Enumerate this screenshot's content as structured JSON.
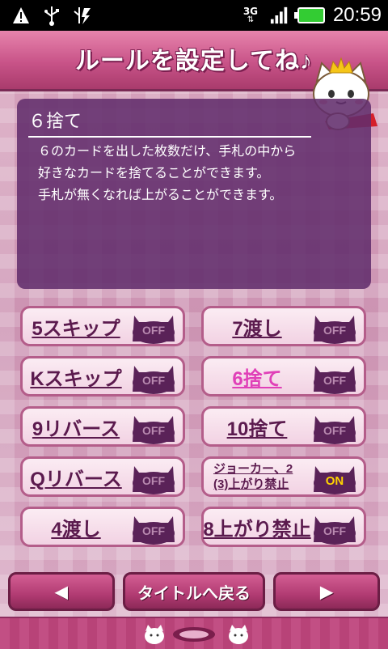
{
  "status_bar": {
    "network": "3G",
    "time": "20:59",
    "icons": [
      "warning-icon",
      "usb-icon",
      "usb-debug-icon",
      "signal-icon",
      "battery-icon"
    ]
  },
  "header": {
    "title": "ルールを設定してね♪"
  },
  "description": {
    "title": "６捨て",
    "lines": [
      "６のカードを出した枚数だけ、手札の中から",
      "好きなカードを捨てることができます。",
      "手札が無くなれば上がることができます。"
    ]
  },
  "rules": [
    {
      "label": "5スキップ",
      "state": "OFF"
    },
    {
      "label": "7渡し",
      "state": "OFF"
    },
    {
      "label": "Kスキップ",
      "state": "OFF"
    },
    {
      "label": "6捨て",
      "state": "OFF",
      "selected": true
    },
    {
      "label": "9リバース",
      "state": "OFF"
    },
    {
      "label": "10捨て",
      "state": "OFF"
    },
    {
      "label": "Qリバース",
      "state": "OFF"
    },
    {
      "label_line1": "ジョーカー、2",
      "label_line2": "(3)上がり禁止",
      "state": "ON"
    },
    {
      "label": "4渡し",
      "state": "OFF"
    },
    {
      "label": "8上がり禁止",
      "state": "OFF"
    }
  ],
  "nav": {
    "prev": "◀",
    "title_back": "タイトルへ戻る",
    "next": "▶"
  },
  "colors": {
    "header": "#c85388",
    "panel": "#622d6c",
    "toggle_off_text": "#b98ab0",
    "toggle_on_text": "#ffd400",
    "selected_label": "#e040b8"
  }
}
